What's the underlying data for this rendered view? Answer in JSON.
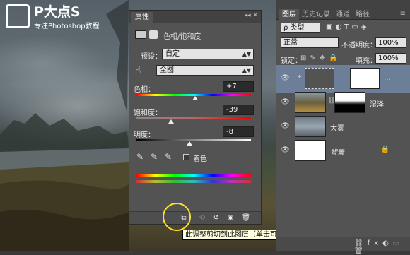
{
  "brand": {
    "title": "P大点S",
    "subtitle": "专注Photoshop教程"
  },
  "properties": {
    "tab": "属性",
    "adjustment_title": "色相/饱和度",
    "preset_label": "预设：",
    "preset_value": "自定",
    "channel_value": "全图",
    "hue_label": "色相：",
    "hue_value": "+7",
    "saturation_label": "饱和度：",
    "saturation_value": "-39",
    "lightness_label": "明度：",
    "lightness_value": "-8",
    "colorize_label": "着色"
  },
  "tooltip": "此调整剪切到此图层（单击可影响下面的所有图层）",
  "layers_panel": {
    "tabs": [
      "图层",
      "历史记录",
      "通道",
      "路径"
    ],
    "filter_value": "ρ 类型",
    "blend_mode": "正常",
    "opacity_label": "不透明度：",
    "opacity_value": "100%",
    "lock_label": "锁定：",
    "fill_label": "填充：",
    "fill_value": "100%",
    "layers": [
      {
        "name": "..."
      },
      {
        "name": "湿泽"
      },
      {
        "name": "大雾"
      },
      {
        "name": "背景"
      }
    ]
  },
  "colors": {
    "accent": "#ffe226",
    "selected_layer": "#6d7e98"
  }
}
